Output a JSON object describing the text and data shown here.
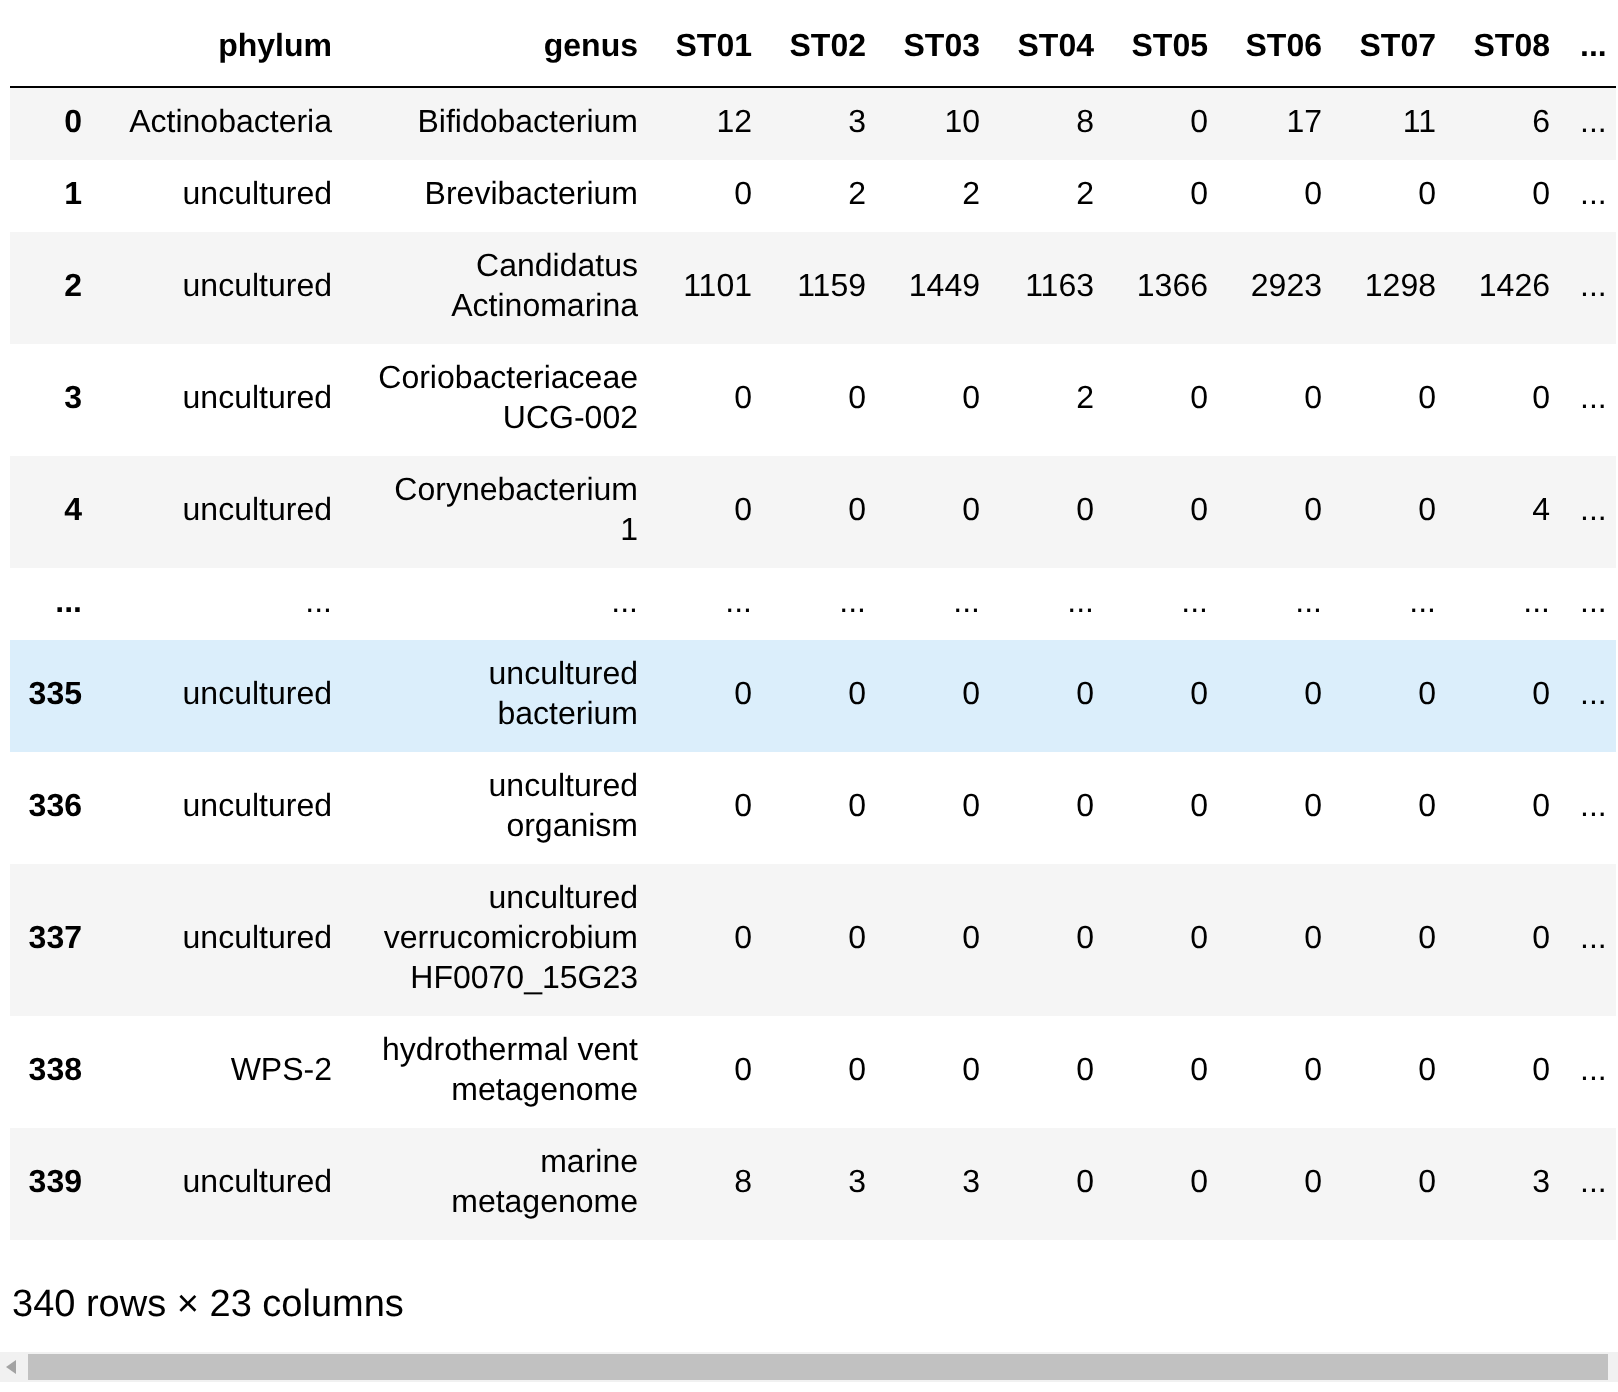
{
  "table": {
    "columns": [
      "",
      "phylum",
      "genus",
      "ST01",
      "ST02",
      "ST03",
      "ST04",
      "ST05",
      "ST06",
      "ST07",
      "ST08",
      "..."
    ],
    "rows": [
      {
        "cells": [
          "0",
          "Actinobacteria",
          "Bifidobacterium",
          "12",
          "3",
          "10",
          "8",
          "0",
          "17",
          "11",
          "6",
          "..."
        ],
        "highlighted": false
      },
      {
        "cells": [
          "1",
          "uncultured",
          "Brevibacterium",
          "0",
          "2",
          "2",
          "2",
          "0",
          "0",
          "0",
          "0",
          "..."
        ],
        "highlighted": false
      },
      {
        "cells": [
          "2",
          "uncultured",
          "Candidatus\nActinomarina",
          "1101",
          "1159",
          "1449",
          "1163",
          "1366",
          "2923",
          "1298",
          "1426",
          "..."
        ],
        "highlighted": false
      },
      {
        "cells": [
          "3",
          "uncultured",
          "Coriobacteriaceae\nUCG-002",
          "0",
          "0",
          "0",
          "2",
          "0",
          "0",
          "0",
          "0",
          "..."
        ],
        "highlighted": false
      },
      {
        "cells": [
          "4",
          "uncultured",
          "Corynebacterium\n1",
          "0",
          "0",
          "0",
          "0",
          "0",
          "0",
          "0",
          "4",
          "..."
        ],
        "highlighted": false
      },
      {
        "cells": [
          "...",
          "...",
          "...",
          "...",
          "...",
          "...",
          "...",
          "...",
          "...",
          "...",
          "...",
          "..."
        ],
        "highlighted": false
      },
      {
        "cells": [
          "335",
          "uncultured",
          "uncultured\nbacterium",
          "0",
          "0",
          "0",
          "0",
          "0",
          "0",
          "0",
          "0",
          "..."
        ],
        "highlighted": true
      },
      {
        "cells": [
          "336",
          "uncultured",
          "uncultured\norganism",
          "0",
          "0",
          "0",
          "0",
          "0",
          "0",
          "0",
          "0",
          "..."
        ],
        "highlighted": false
      },
      {
        "cells": [
          "337",
          "uncultured",
          "uncultured\nverrucomicrobium\nHF0070_15G23",
          "0",
          "0",
          "0",
          "0",
          "0",
          "0",
          "0",
          "0",
          "..."
        ],
        "highlighted": false
      },
      {
        "cells": [
          "338",
          "WPS-2",
          "hydrothermal vent\nmetagenome",
          "0",
          "0",
          "0",
          "0",
          "0",
          "0",
          "0",
          "0",
          "..."
        ],
        "highlighted": false
      },
      {
        "cells": [
          "339",
          "uncultured",
          "marine\nmetagenome",
          "8",
          "3",
          "3",
          "0",
          "0",
          "0",
          "0",
          "3",
          "..."
        ],
        "highlighted": false
      }
    ]
  },
  "summary": "340 rows × 23 columns"
}
